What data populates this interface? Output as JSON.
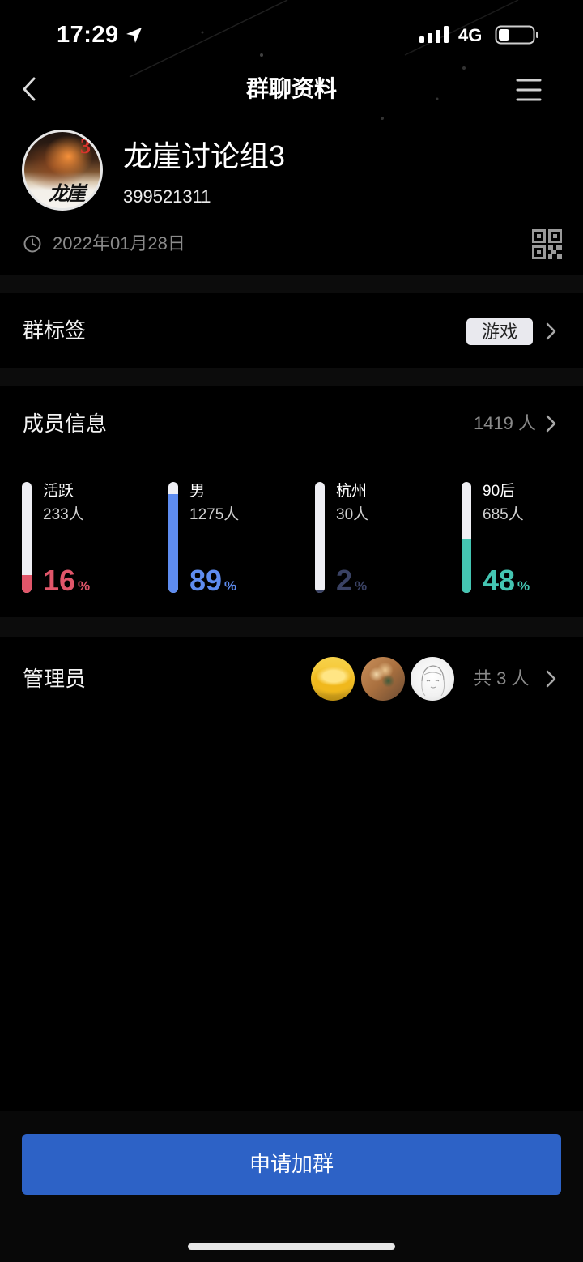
{
  "status_bar": {
    "time": "17:29",
    "network": "4G"
  },
  "nav": {
    "title": "群聊资料"
  },
  "group": {
    "name": "龙崖讨论组3",
    "id": "399521311",
    "created_date": "2022年01月28日",
    "avatar_lettering": {
      "number": "3",
      "text": "龙崖"
    }
  },
  "tags": {
    "label": "群标签",
    "tag": "游戏"
  },
  "members": {
    "label": "成员信息",
    "count": "1419 人",
    "percent_unit": "%",
    "stats": [
      {
        "label": "活跃",
        "count": "233人",
        "percent": 16,
        "color": "#e1566a"
      },
      {
        "label": "男",
        "count": "1275人",
        "percent": 89,
        "color": "#5e8cf0"
      },
      {
        "label": "杭州",
        "count": "30人",
        "percent": 2,
        "color": "#3a4264"
      },
      {
        "label": "90后",
        "count": "685人",
        "percent": 48,
        "color": "#44c5b2"
      }
    ]
  },
  "admins": {
    "label": "管理员",
    "count": "共 3 人"
  },
  "action": {
    "join_label": "申请加群",
    "color": "#2d62c6"
  },
  "icons": [
    "location-arrow-icon",
    "signal-bars-icon",
    "battery-icon",
    "chevron-left-icon",
    "menu-icon",
    "clock-icon",
    "qr-code-icon",
    "chevron-right-icon"
  ]
}
